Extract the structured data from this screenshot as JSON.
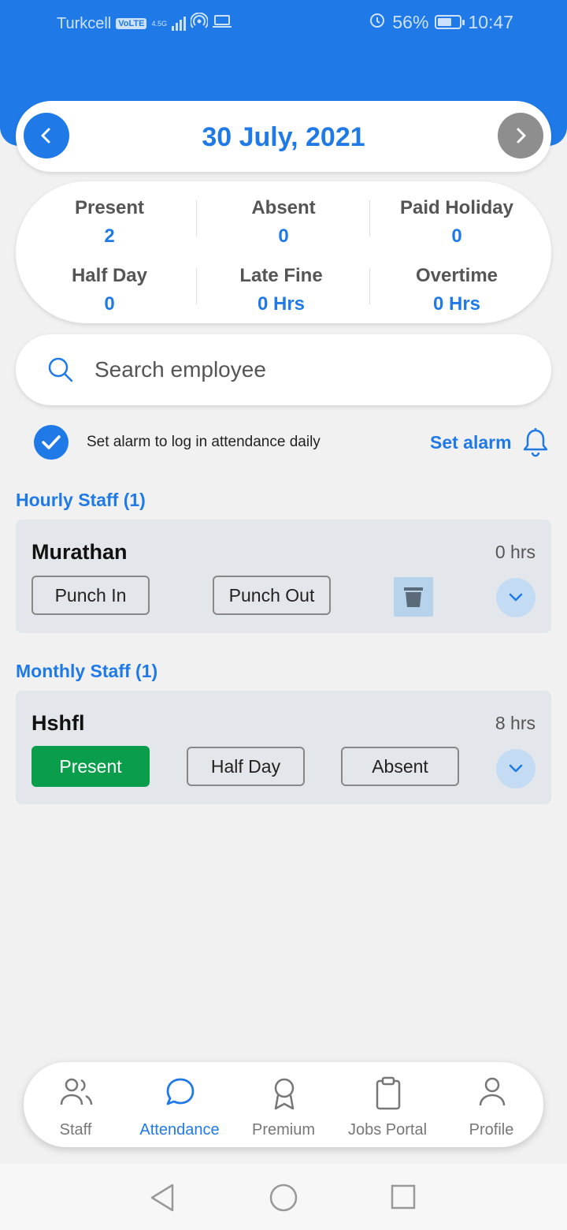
{
  "status_bar": {
    "carrier": "Turkcell",
    "volte": "VoLTE",
    "network": "4.5G",
    "battery": "56%",
    "time": "10:47"
  },
  "date_nav": {
    "date": "30 July, 2021",
    "prev_icon": "chevron-left-icon",
    "next_icon": "chevron-right-icon"
  },
  "summary": {
    "items": [
      {
        "label": "Present",
        "value": "2"
      },
      {
        "label": "Absent",
        "value": "0"
      },
      {
        "label": "Paid Holiday",
        "value": "0"
      },
      {
        "label": "Half Day",
        "value": "0"
      },
      {
        "label": "Late Fine",
        "value": "0 Hrs"
      },
      {
        "label": "Overtime",
        "value": "0 Hrs"
      }
    ]
  },
  "search": {
    "placeholder": "Search employee",
    "value": ""
  },
  "alarm": {
    "checked": true,
    "text": "Set alarm to log in attendance daily",
    "action": "Set alarm"
  },
  "hourly": {
    "title": "Hourly Staff (1)",
    "staff": {
      "name": "Murathan",
      "hours": "0 hrs",
      "punch_in": "Punch In",
      "punch_out": "Punch Out"
    }
  },
  "monthly": {
    "title": "Monthly Staff (1)",
    "staff": {
      "name": "Hshfl",
      "hours": "8 hrs",
      "present": "Present",
      "half_day": "Half Day",
      "absent": "Absent"
    }
  },
  "bottom_nav": {
    "items": [
      {
        "label": "Staff",
        "icon": "users-icon"
      },
      {
        "label": "Attendance",
        "icon": "chat-bubble-icon"
      },
      {
        "label": "Premium",
        "icon": "award-icon"
      },
      {
        "label": "Jobs Portal",
        "icon": "clipboard-icon"
      },
      {
        "label": "Profile",
        "icon": "user-icon"
      }
    ],
    "active": "Attendance"
  },
  "colors": {
    "primary": "#1f7ae8",
    "present_green": "#0a9d4c",
    "card_bg": "#e3e6ea",
    "page_bg": "#f1f1f1"
  }
}
